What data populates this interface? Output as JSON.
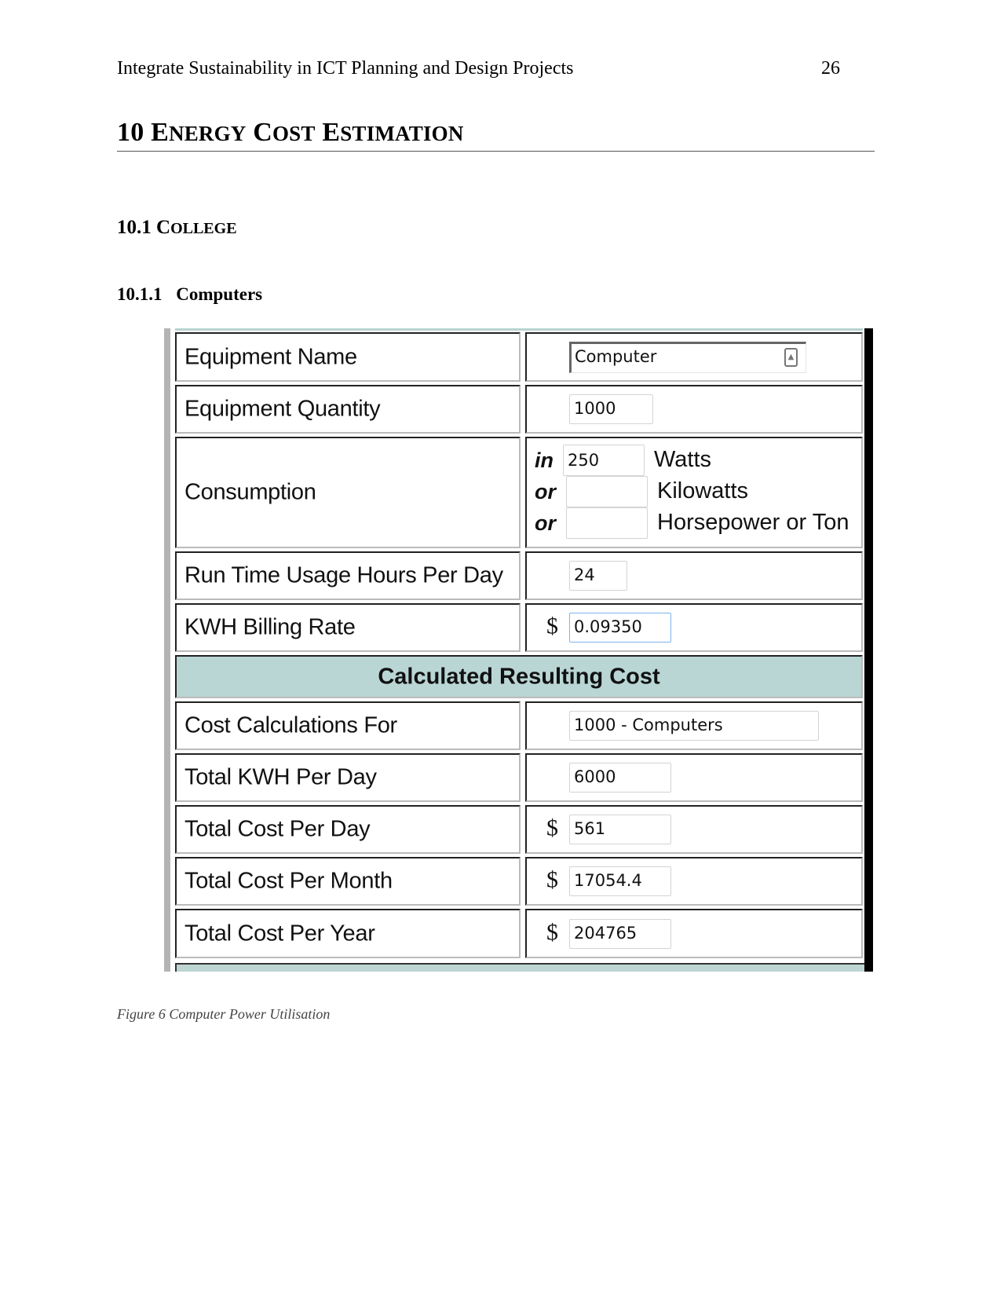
{
  "page": {
    "running_head": "Integrate Sustainability in ICT Planning and Design Projects",
    "page_number": "26"
  },
  "headings": {
    "h1_number": "10",
    "h1_parts": [
      {
        "cap": "E",
        "rest": "NERGY"
      },
      {
        "cap": "C",
        "rest": "OST"
      },
      {
        "cap": "E",
        "rest": "STIMATION"
      }
    ],
    "h1_full": "10 Energy Cost Estimation",
    "h2_number": "10.1",
    "h2_cap": "C",
    "h2_rest": "OLLEGE",
    "h3_number": "10.1.1",
    "h3_title": "Computers"
  },
  "figure": {
    "caption": "Figure 6 Computer Power Utilisation",
    "colors": {
      "header_band": "#b9d6d5",
      "focus_border": "#7eb4ea"
    },
    "inputs": {
      "equipment_name": {
        "label": "Equipment Name",
        "value": "Computer",
        "icon": "spinner-icon"
      },
      "equipment_quantity": {
        "label": "Equipment Quantity",
        "value": "1000"
      },
      "consumption": {
        "label": "Consumption",
        "lines": [
          {
            "keyword": "in",
            "value": "250",
            "unit": "Watts"
          },
          {
            "keyword": "or",
            "value": "",
            "unit": "Kilowatts"
          },
          {
            "keyword": "or",
            "value": "",
            "unit": "Horsepower or Ton"
          }
        ]
      },
      "run_time": {
        "label": "Run Time Usage Hours Per Day",
        "value": "24"
      },
      "billing_rate": {
        "label": "KWH Billing Rate",
        "currency": "$",
        "value": "0.09350"
      }
    },
    "results_header": "Calculated Resulting Cost",
    "results": {
      "cost_for": {
        "label": "Cost Calculations For",
        "value": "1000 - Computers"
      },
      "kwh_per_day": {
        "label": "Total KWH Per Day",
        "value": "6000"
      },
      "cost_per_day": {
        "label": "Total Cost Per Day",
        "currency": "$",
        "value": "561"
      },
      "cost_per_month": {
        "label": "Total Cost Per Month",
        "currency": "$",
        "value": "17054.4"
      },
      "cost_per_year": {
        "label": "Total Cost Per Year",
        "currency": "$",
        "value": "204765"
      }
    }
  }
}
